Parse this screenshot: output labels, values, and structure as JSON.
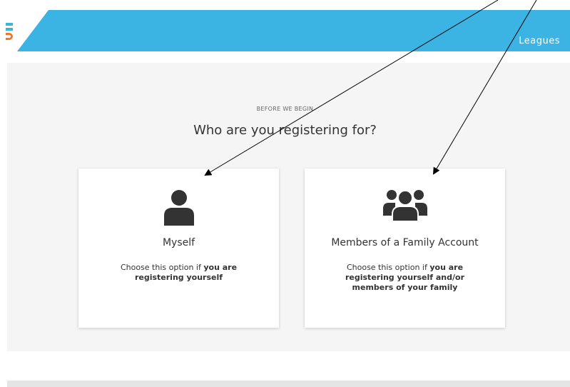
{
  "header": {
    "nav_link": "Leagues",
    "brand_color": "#3bb3e3",
    "accent_color": "#f4772b"
  },
  "main": {
    "eyebrow": "BEFORE WE BEGIN",
    "headline": "Who are you registering for?"
  },
  "options": {
    "myself": {
      "icon": "person-icon",
      "title": "Myself",
      "desc_pre": "Choose this option if ",
      "desc_bold": "you are registering yourself"
    },
    "family": {
      "icon": "group-icon",
      "title": "Members of a Family Account",
      "desc_pre": "Choose this option if ",
      "desc_bold": "you are registering yourself and/or members of your family"
    }
  }
}
